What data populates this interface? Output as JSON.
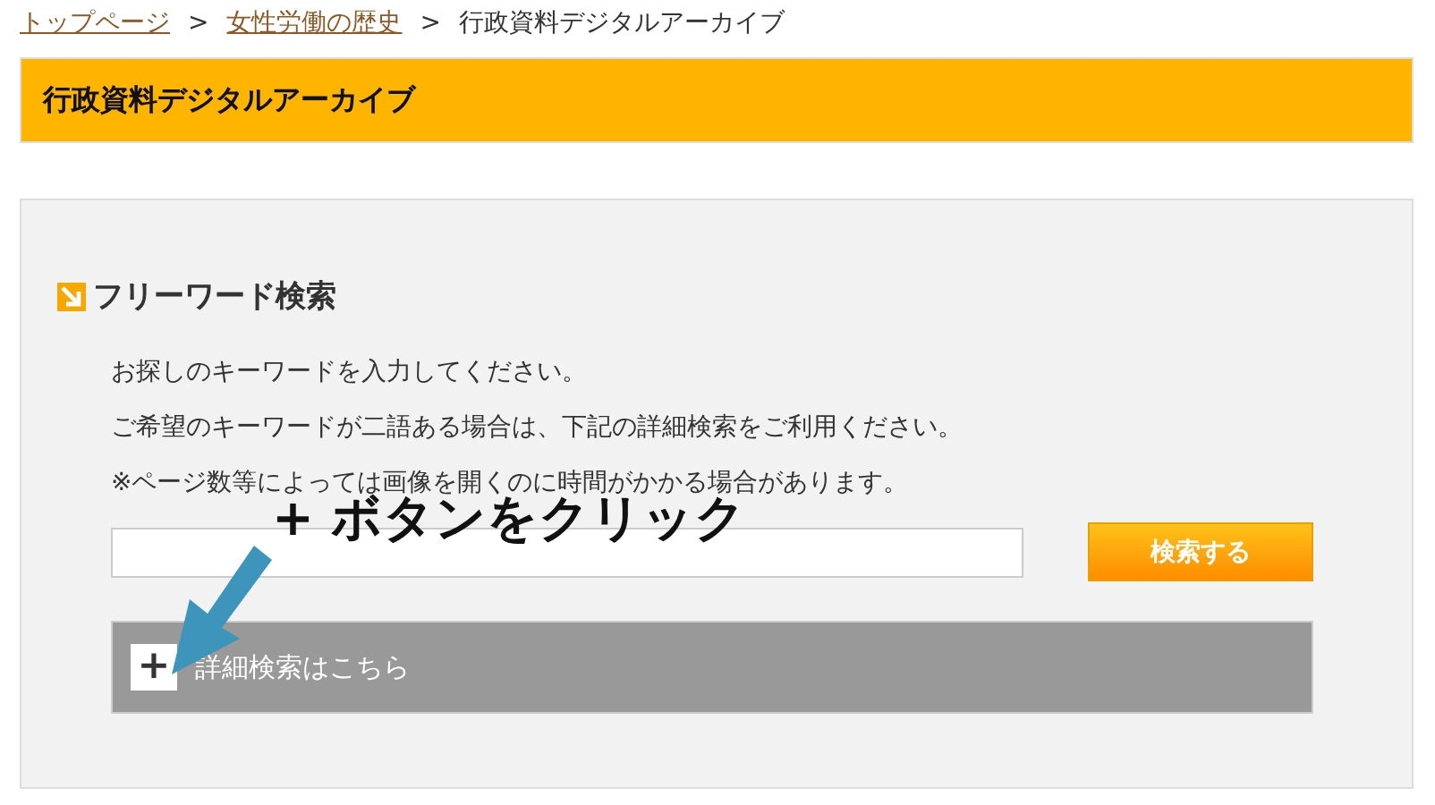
{
  "breadcrumb": [
    {
      "label": "トップページ",
      "link": true
    },
    {
      "label": "女性労働の歴史",
      "link": true
    },
    {
      "label": "行政資料デジタルアーカイブ",
      "link": false
    }
  ],
  "breadcrumb_separator": ">",
  "page_title": "行政資料デジタルアーカイブ",
  "section": {
    "heading": "フリーワード検索",
    "instructions": [
      "お探しのキーワードを入力してください。",
      "ご希望のキーワードが二語ある場合は、下記の詳細検索をご利用ください。",
      "※ページ数等によっては画像を開くのに時間がかかる場合があります。"
    ],
    "search_button": "検索する",
    "advanced": {
      "toggle": "+",
      "label": "詳細検索はこちら",
      "expanded": false
    }
  },
  "annotation": {
    "text": "+ ボタンをクリック"
  }
}
